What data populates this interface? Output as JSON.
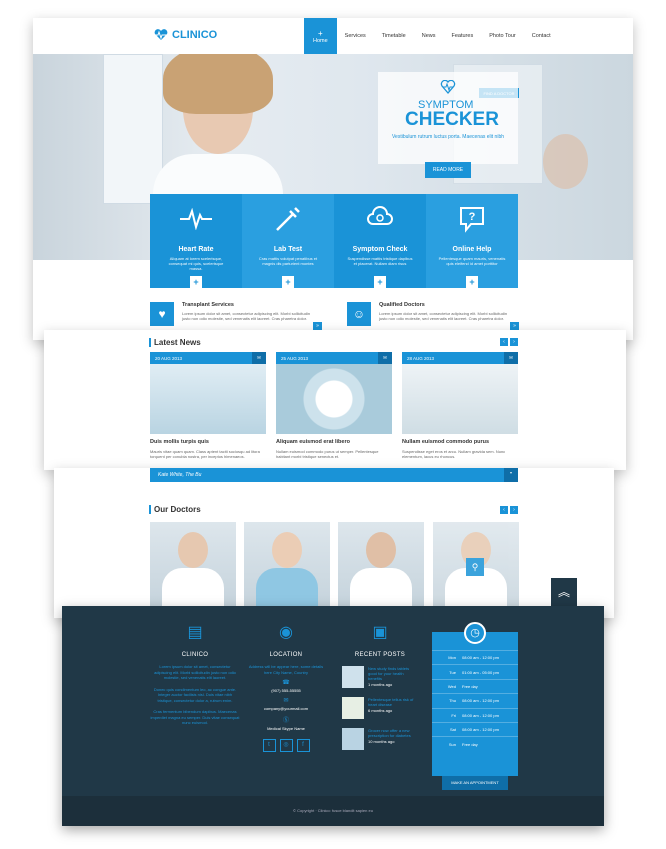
{
  "header": {
    "logo": "CLINICO",
    "nav": [
      "Home",
      "Services",
      "Timetable",
      "News",
      "Features",
      "Photo Tour",
      "Contact"
    ]
  },
  "hero": {
    "find": "FIND A DOCTOR",
    "title1": "SYMPTOM",
    "title2": "CHECKER",
    "subtitle": "Vestibulum rutrum luctus porta. Maecenas elit nibh",
    "button": "READ MORE"
  },
  "tiles": [
    {
      "icon": "heart-rate-icon",
      "name": "Heart Rate",
      "desc": "Aliquam at lorem scelerisque, consequat mi quis, scelerisque massa."
    },
    {
      "icon": "syringe-icon",
      "name": "Lab Test",
      "desc": "Cras mattis volutpat penatibus et magnis dis parturient montes"
    },
    {
      "icon": "stethoscope-icon",
      "name": "Symptom Check",
      "desc": "Suspendisse mattis tristique dapibus et placerat. Nullam diam risus"
    },
    {
      "icon": "online-help-icon",
      "name": "Online Help",
      "desc": "Pellentesque quam mauris, venenatis quis eleifend id amet porttitor"
    }
  ],
  "services": [
    {
      "title": "Transplant Services",
      "desc": "Lorem ipsum dolor sit amet, consectetur adipiscing elit. Morbi sollicitudin justo non odio molestie, sed venenatis elit laoreet. Cras pharetra dolor."
    },
    {
      "title": "Qualified Doctors",
      "desc": "Lorem ipsum dolor sit amet, consectetur adipiscing elit. Morbi sollicitudin justo non odio molestie, sed venenatis elit laoreet. Cras pharetra dolor."
    }
  ],
  "news": {
    "title": "Latest News",
    "items": [
      {
        "date": "20 AUG 2013",
        "title": "Duis mollis turpis quis",
        "desc": "Mauris vitae quam quam. Class aptent taciti sociosqu ad litora torquent per conubia nostra, per inceptos himenaeos."
      },
      {
        "date": "25 AUG 2013",
        "title": "Aliquam euismod erat libero",
        "desc": "Nullam euismod commodo purus ut semper. Pellentesque habitant morbi tristique senectus et."
      },
      {
        "date": "28 AUG 2013",
        "title": "Nullam euismod commodo purus",
        "desc": "Suspendisse eget eros et arcu. Nullam gravida sem. Nunc elementum, lacus eu rhoncus."
      }
    ]
  },
  "doctors": {
    "quote": "Kate White, The Bu",
    "title": "Our Doctors"
  },
  "footer": {
    "clinico": {
      "title": "CLINICO",
      "p1": "Lorem ipsum dolor sit amet, consectetur adipiscing elit. Morbi sollicitudin justo non odio molestie, sed venenatis elit laoreet.",
      "p2": "Donec quis condimentum leo, ac congue ante. Integer auctor facilisis nisl. Duis vitae nibh tristique, consectetur dolor a, rutrum enim.",
      "p3": "Cras fermentum bibendum dapibus. Maecenas imperdiet magna eu semper. Duis vitae consequat nunc euismod."
    },
    "location": {
      "title": "LOCATION",
      "address": "Address will be appear here, some details here City Name, Country",
      "phone": "(907) 555-55555",
      "email": "company@yourmail.com",
      "skype": "Medical Skype Name"
    },
    "posts": {
      "title": "RECENT POSTS",
      "items": [
        {
          "title": "New study finds tablets good for your health benefits",
          "meta": "1 months ago"
        },
        {
          "title": "Pellentesque tellus risk of heart disease",
          "meta": "6 months ago"
        },
        {
          "title": "Grocer now offer a new prescription for diabetes",
          "meta": "10 months ago"
        }
      ]
    },
    "hours": {
      "rows": [
        [
          "Mon",
          "08:00 am - 12:00 pm"
        ],
        [
          "Tue",
          "01:00 am - 05:00 pm"
        ],
        [
          "Wed",
          "Free day"
        ],
        [
          "Thu",
          "08:00 am - 12:00 pm"
        ],
        [
          "Fri",
          "08:00 am - 12:00 pm"
        ],
        [
          "Sat",
          "08:00 am - 12:00 pm"
        ],
        [
          "Sun",
          "Free day"
        ]
      ],
      "button": "MAKE AN APPOINTMENT"
    },
    "copyright": "© Copyright · Clinico: fusce blandit sapien eu"
  }
}
